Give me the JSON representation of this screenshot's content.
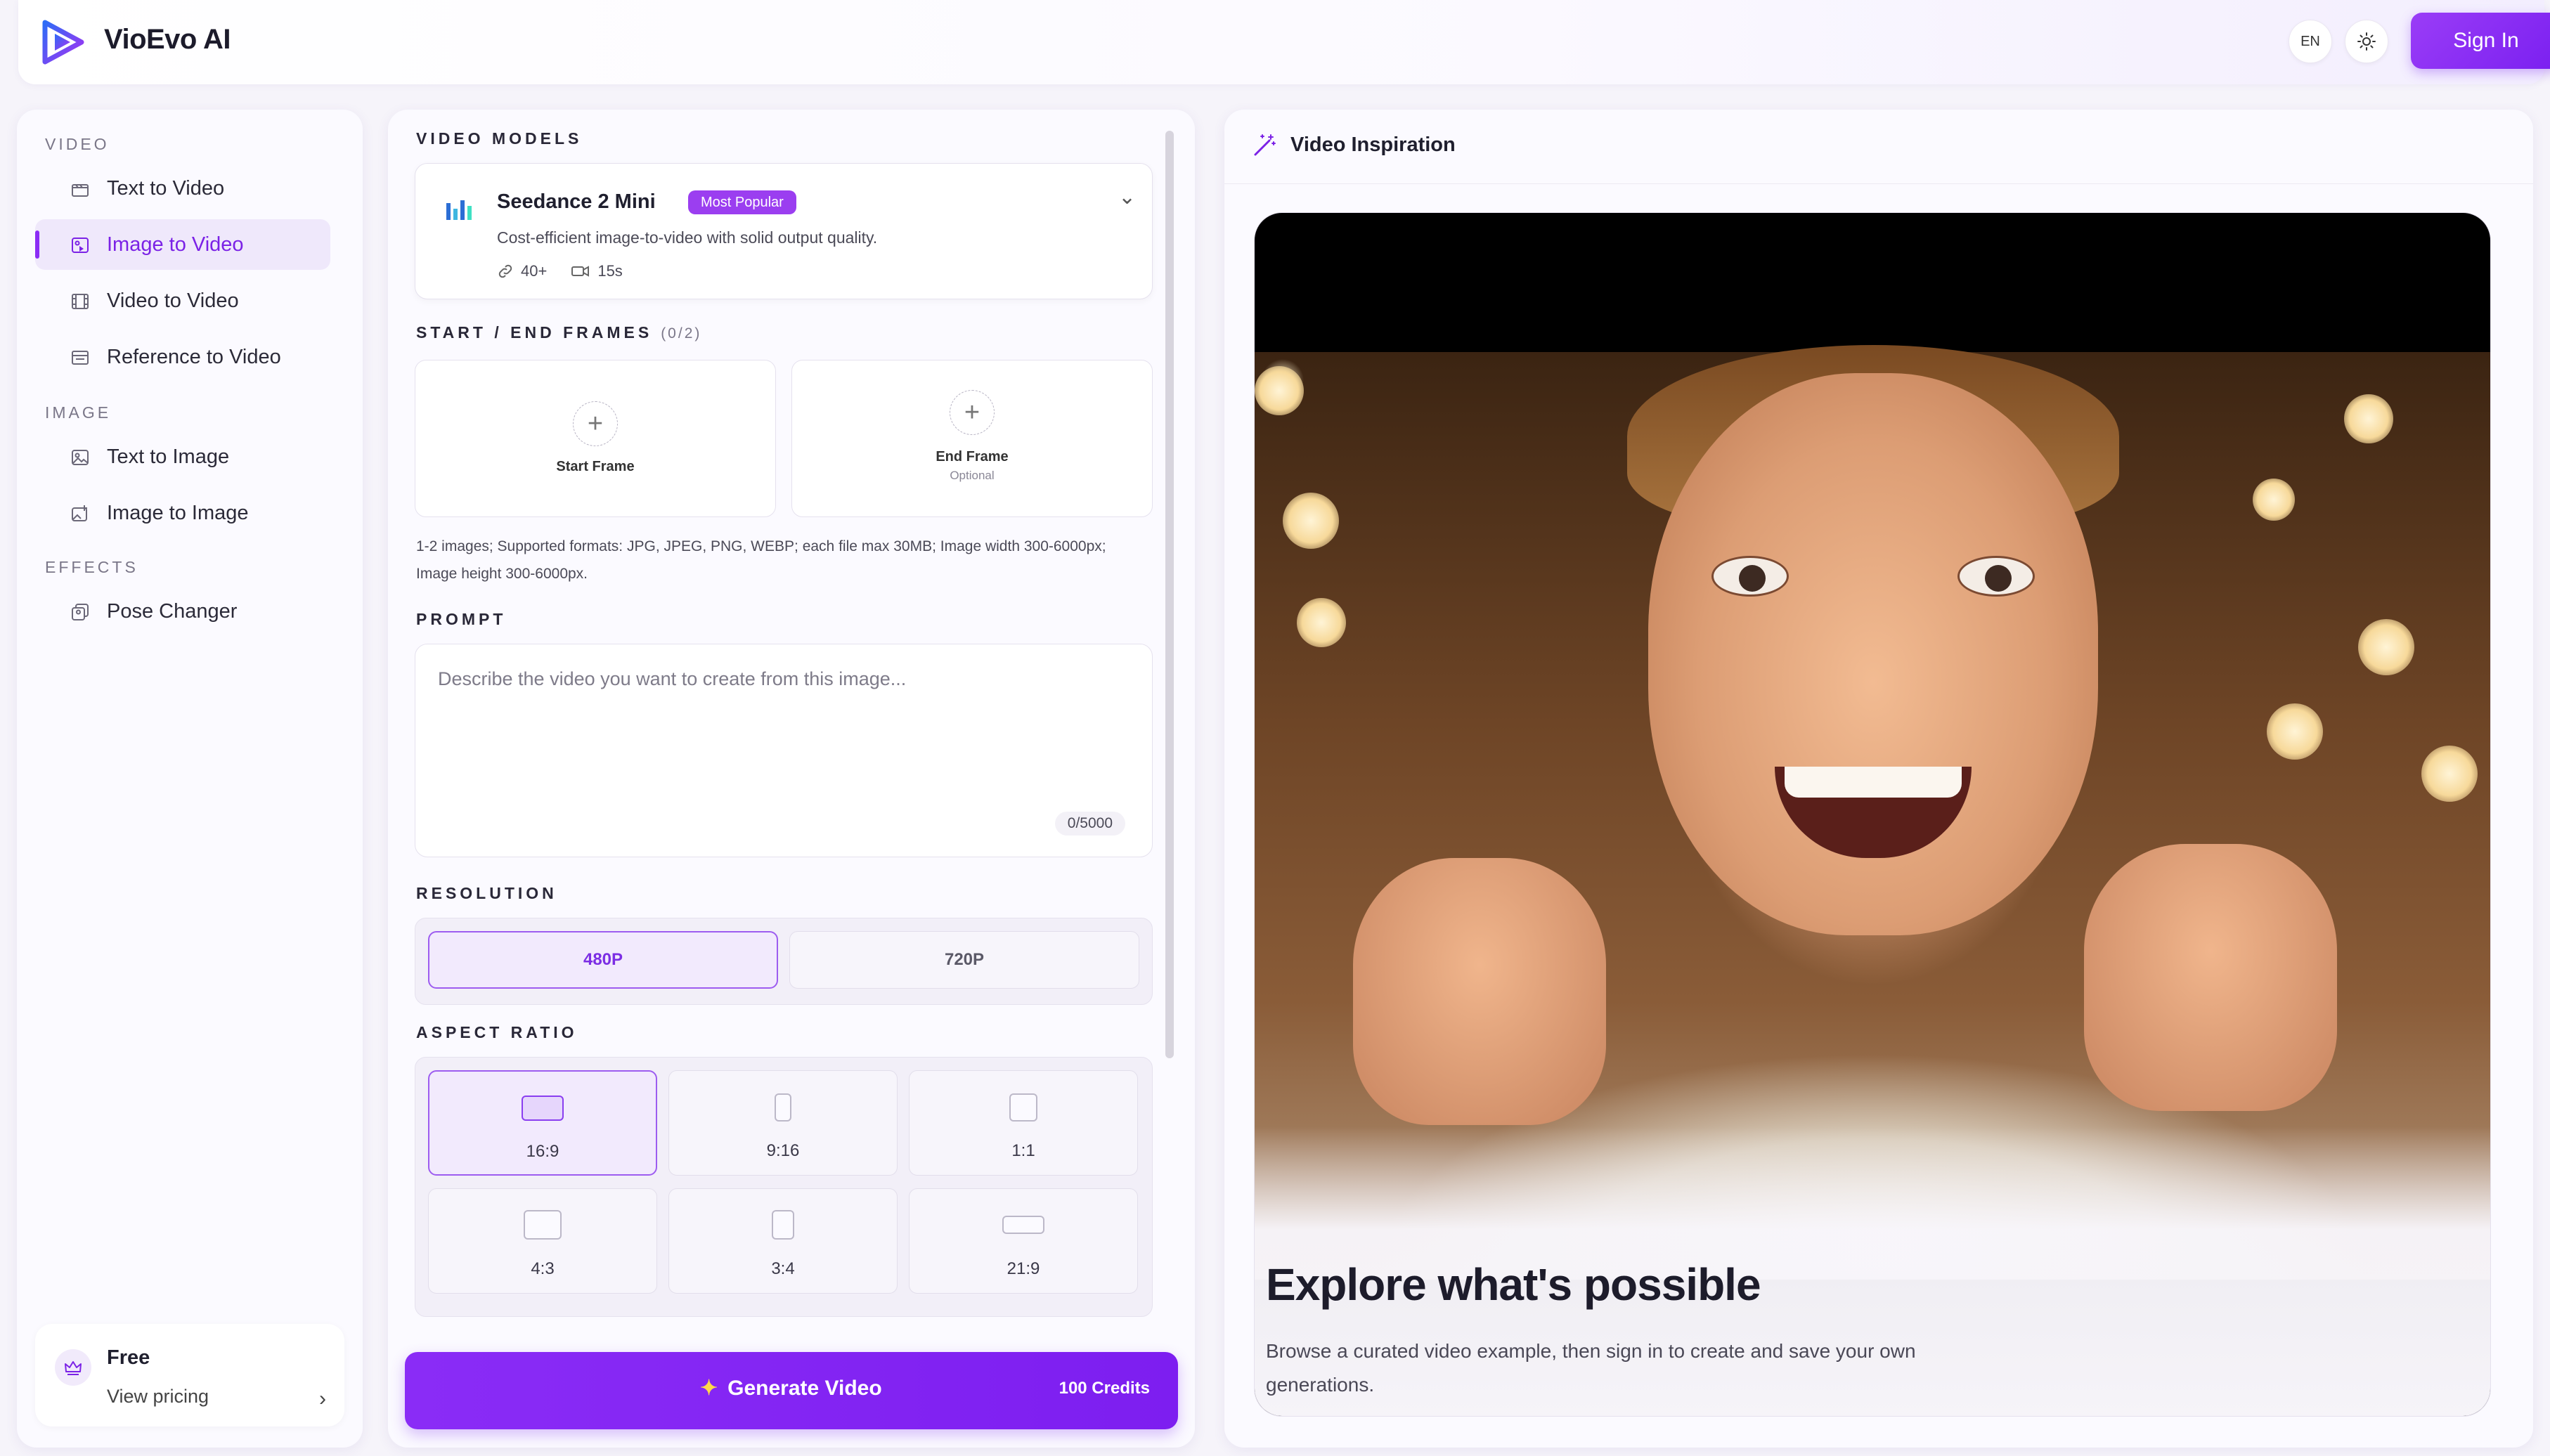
{
  "app": {
    "brand": "VioEvo AI",
    "language": "EN",
    "sign_in_label": "Sign In",
    "accent_color": "#8b2cf5"
  },
  "sidebar": {
    "sections": [
      {
        "label": "VIDEO"
      },
      {
        "label": "IMAGE"
      },
      {
        "label": "EFFECTS"
      }
    ],
    "items": [
      {
        "label": "Text to Video",
        "icon": "clapper-icon"
      },
      {
        "label": "Image to Video",
        "icon": "image-video-icon",
        "active": true
      },
      {
        "label": "Video to Video",
        "icon": "film-icon"
      },
      {
        "label": "Reference to Video",
        "icon": "reference-icon"
      },
      {
        "label": "Text to Image",
        "icon": "image-icon"
      },
      {
        "label": "Image to Image",
        "icon": "image-edit-icon"
      },
      {
        "label": "Pose Changer",
        "icon": "pose-icon"
      }
    ],
    "plan": {
      "name": "Free",
      "link": "View pricing"
    }
  },
  "form": {
    "models_label": "VIDEO MODELS",
    "model": {
      "name": "Seedance 2 Mini",
      "badge": "Most Popular",
      "description": "Cost-efficient image-to-video with solid output quality.",
      "count": "40+",
      "duration": "15s"
    },
    "frames_label": "START / END FRAMES",
    "frames_count": "(0/2)",
    "start_frame": "Start Frame",
    "end_frame": "End Frame",
    "end_optional": "Optional",
    "hint": "1-2 images; Supported formats: JPG, JPEG, PNG, WEBP; each file max 30MB; Image width 300-6000px; Image height 300-6000px.",
    "prompt_label": "PROMPT",
    "prompt_placeholder": "Describe the video you want to create from this image...",
    "prompt_counter": "0/5000",
    "resolution_label": "RESOLUTION",
    "resolutions": [
      "480P",
      "720P"
    ],
    "resolution_selected": "480P",
    "aspect_label": "ASPECT RATIO",
    "aspects": [
      "16:9",
      "9:16",
      "1:1",
      "4:3",
      "3:4",
      "21:9"
    ],
    "aspect_selected": "16:9",
    "generate_label": "Generate Video",
    "credits_label": "100 Credits"
  },
  "inspiration": {
    "title": "Video Inspiration",
    "headline": "Explore what's possible",
    "description": "Browse a curated video example, then sign in to create and save your own generations."
  }
}
